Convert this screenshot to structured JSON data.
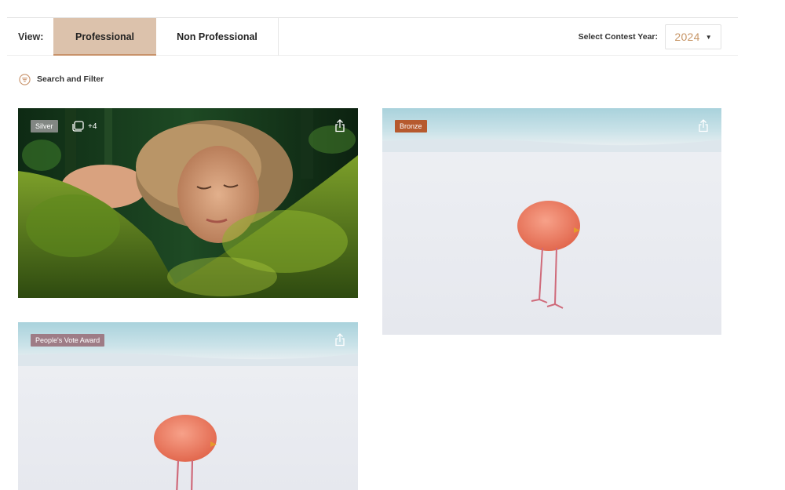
{
  "view_bar": {
    "view_label": "View:",
    "tabs": [
      {
        "label": "Professional",
        "active": true
      },
      {
        "label": "Non Professional",
        "active": false
      }
    ],
    "year_label": "Select Contest Year:",
    "year_value": "2024"
  },
  "filter": {
    "label": "Search and Filter",
    "icon": "filter-lines-icon"
  },
  "gallery": [
    {
      "badge": "Silver",
      "extra_count": "+4",
      "subject": "woman-sleeping-on-moss",
      "share_icon": "share-icon"
    },
    {
      "badge": "Bronze",
      "subject": "flamingo-on-white-sand",
      "share_icon": "share-icon"
    },
    {
      "badge": "People's Vote Award",
      "subject": "flamingo-on-white-sand",
      "share_icon": "share-icon"
    }
  ],
  "colors": {
    "active_tab": "#dcc2ac",
    "accent": "#c79566",
    "badge_bronze": "#b65a2e",
    "badge_people": "#9e7c86"
  }
}
